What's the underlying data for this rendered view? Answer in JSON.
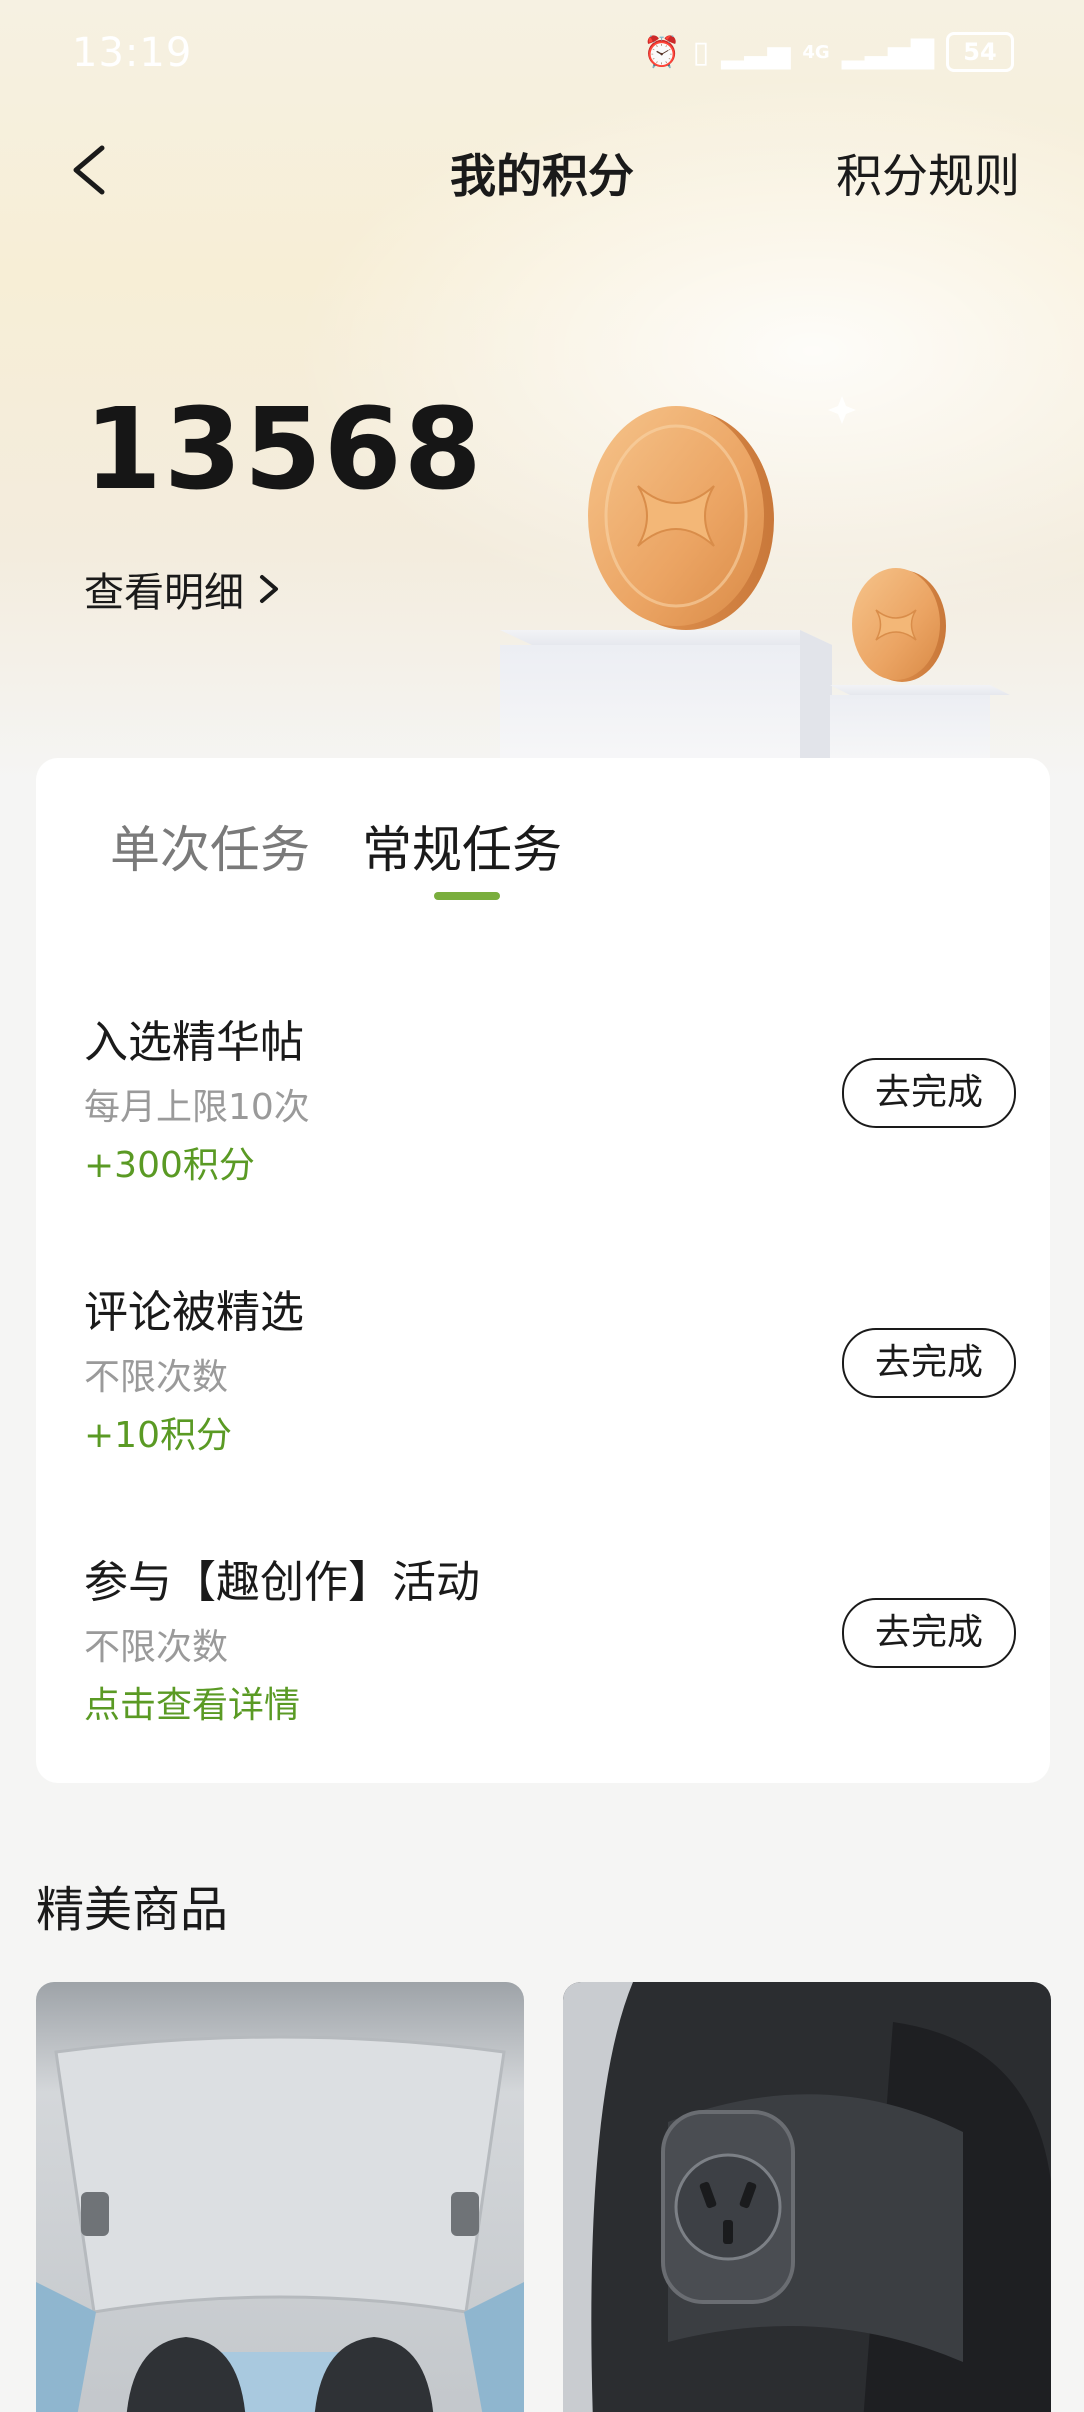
{
  "status_bar": {
    "time": "13:19",
    "battery": "54",
    "network": "4G"
  },
  "nav": {
    "title": "我的积分",
    "rules_label": "积分规则"
  },
  "points": {
    "value": "13568",
    "detail_label": "查看明细"
  },
  "tabs": [
    {
      "label": "单次任务",
      "active": false
    },
    {
      "label": "常规任务",
      "active": true
    }
  ],
  "tasks": [
    {
      "title": "入选精华帖",
      "limit": "每月上限10次",
      "reward": "+300积分",
      "button": "去完成"
    },
    {
      "title": "评论被精选",
      "limit": "不限次数",
      "reward": "+10积分",
      "button": "去完成"
    },
    {
      "title": "参与【趣创作】活动",
      "limit": "不限次数",
      "reward": "点击查看详情",
      "button": "去完成"
    }
  ],
  "products": {
    "title": "精美商品"
  },
  "colors": {
    "accent_green": "#5a9a24",
    "tab_indicator": "#7aae3d",
    "hero_gold": "#e9a767"
  }
}
